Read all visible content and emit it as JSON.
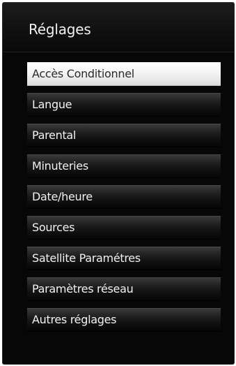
{
  "header": {
    "title": "Réglages"
  },
  "menu": {
    "items": [
      {
        "label": "Accès Conditionnel",
        "selected": true
      },
      {
        "label": "Langue"
      },
      {
        "label": "Parental"
      },
      {
        "label": "Minuteries"
      },
      {
        "label": "Date/heure"
      },
      {
        "label": "Sources"
      },
      {
        "label": "Satellite Paramétres"
      },
      {
        "label": "Paramètres réseau"
      },
      {
        "label": "Autres réglages"
      }
    ]
  },
  "colors": {
    "background": "#070707",
    "highlight": "#f4f4f4",
    "text": "#f2f2f2",
    "selected_text": "#2a2a2a"
  }
}
